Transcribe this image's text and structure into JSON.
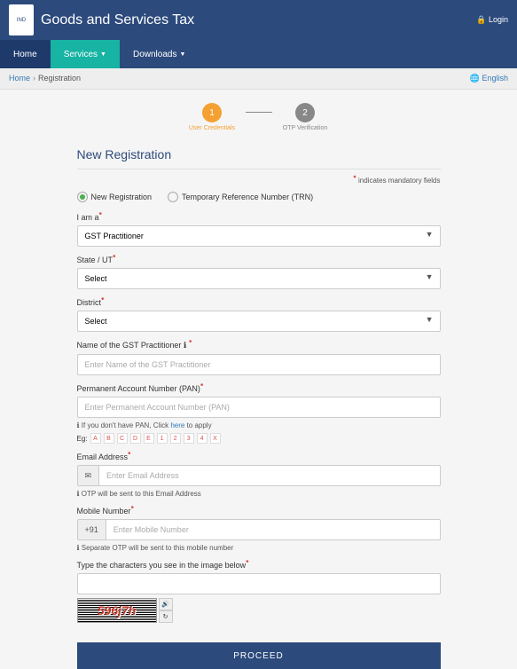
{
  "header": {
    "title": "Goods and Services Tax",
    "login": "Login"
  },
  "nav": {
    "home": "Home",
    "services": "Services",
    "downloads": "Downloads"
  },
  "breadcrumb": {
    "home": "Home",
    "current": "Registration",
    "lang": "English"
  },
  "steps": {
    "s1": {
      "num": "1",
      "label": "User Credentials"
    },
    "s2": {
      "num": "2",
      "label": "OTP Verification"
    }
  },
  "form": {
    "title": "New Registration",
    "mandatory": "indicates mandatory fields",
    "radio": {
      "new": "New Registration",
      "trn": "Temporary Reference Number (TRN)"
    },
    "iam": {
      "label": "I am a",
      "value": "GST Practitioner"
    },
    "state": {
      "label": "State / UT",
      "value": "Select"
    },
    "district": {
      "label": "District",
      "value": "Select"
    },
    "name": {
      "label": "Name of the GST Practitioner",
      "placeholder": "Enter Name of the GST Practitioner"
    },
    "pan": {
      "label": "Permanent Account Number (PAN)",
      "placeholder": "Enter Permanent Account Number (PAN)",
      "note_pre": "If you don't have PAN, Click ",
      "note_link": "here",
      "note_post": " to apply",
      "eg_label": "Eg:",
      "eg": [
        "A",
        "B",
        "C",
        "D",
        "E",
        "1",
        "2",
        "3",
        "4",
        "X"
      ]
    },
    "email": {
      "label": "Email Address",
      "placeholder": "Enter Email Address",
      "note": "OTP will be sent to this Email Address",
      "icon": "✉"
    },
    "mobile": {
      "label": "Mobile Number",
      "prefix": "+91",
      "placeholder": "Enter Mobile Number",
      "note": "Separate OTP will be sent to this mobile number"
    },
    "captcha": {
      "label": "Type the characters you see in the image below",
      "text": "596j7h",
      "audio": "🔊",
      "refresh": "↻"
    },
    "proceed": "PROCEED"
  }
}
